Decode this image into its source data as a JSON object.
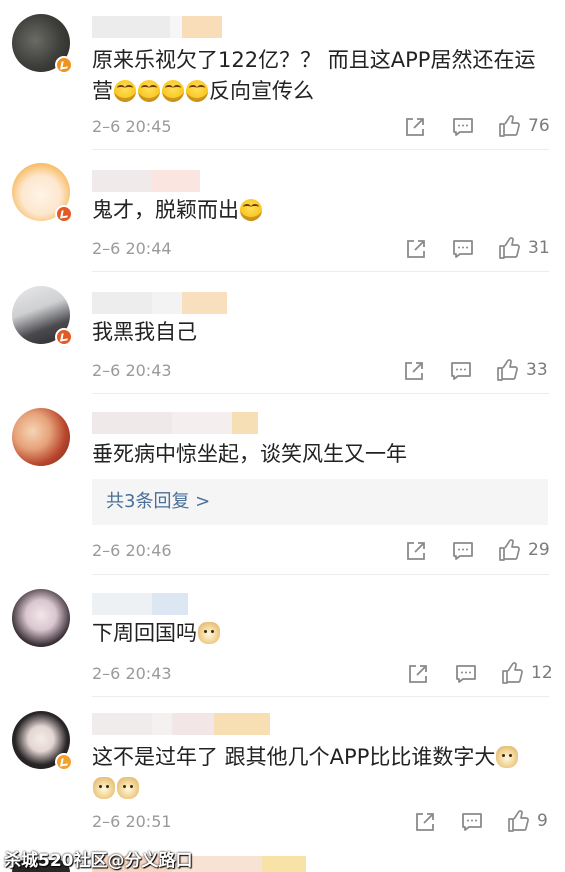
{
  "comments": [
    {
      "text": "原来乐视欠了122亿？？ 而且这APP居然还在运营",
      "trailing_text": "反向宣传么",
      "emojis": [
        "laugh-emoji",
        "laugh-emoji",
        "laugh-emoji",
        "laugh-emoji"
      ],
      "time": "2–6 20:45",
      "likes": "76"
    },
    {
      "text": "鬼才，脱颖而出",
      "emojis": [
        "laugh-emoji"
      ],
      "time": "2–6 20:44",
      "likes": "31"
    },
    {
      "text": "我黑我自己",
      "emojis": [],
      "time": "2–6 20:43",
      "likes": "33"
    },
    {
      "text": "垂死病中惊坐起，谈笑风生又一年",
      "emojis": [],
      "time": "2–6 20:46",
      "likes": "29",
      "reply_label": "共3条回复 >"
    },
    {
      "text": "下周回国吗",
      "emojis": [
        "doge-emoji"
      ],
      "time": "2–6 20:43",
      "likes": "12"
    },
    {
      "text": "这不是过年了 跟其他几个APP比比谁数字大",
      "emojis": [
        "doge-emoji",
        "doge-emoji",
        "doge-emoji"
      ],
      "time": "2–6 20:51",
      "likes": "9"
    }
  ],
  "watermark": "杀城520社区@分义路口",
  "icons": {
    "repost": "repost-icon",
    "comment": "comment-icon",
    "like": "like-icon"
  },
  "colors": {
    "reply_link": "#4a6f99",
    "meta": "#9a9a9a",
    "badge": "#f0921f"
  }
}
